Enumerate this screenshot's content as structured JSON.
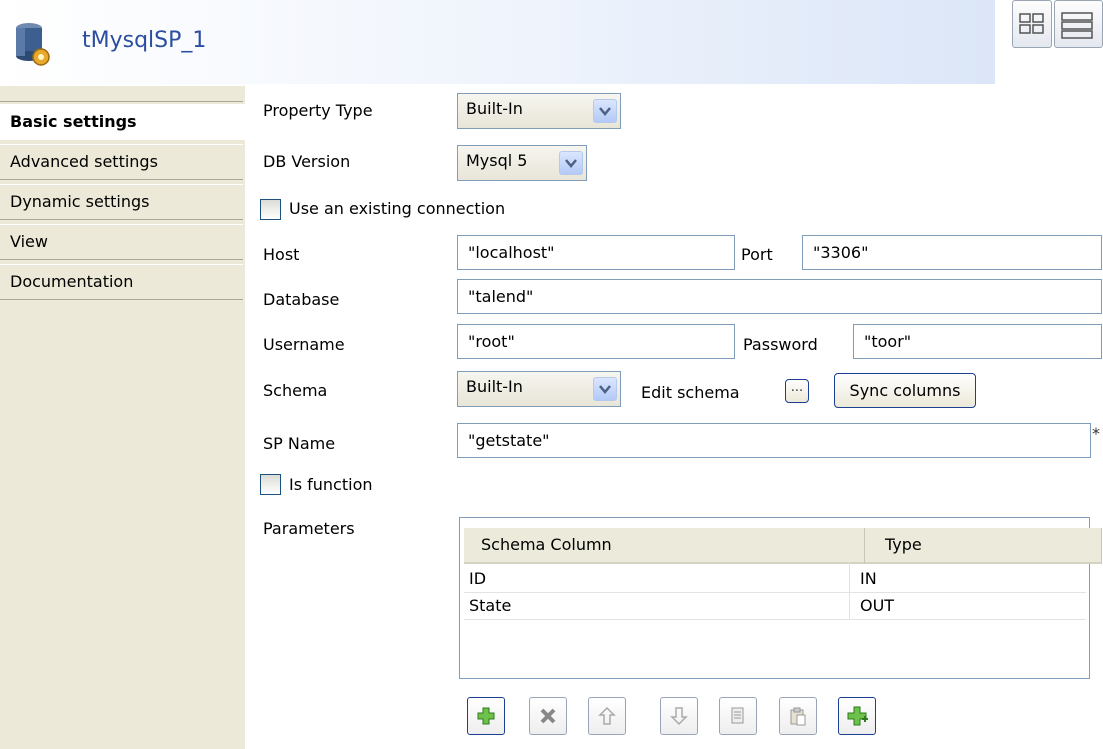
{
  "header": {
    "title": "tMysqlSP_1"
  },
  "nav": {
    "items": [
      {
        "label": "Basic settings"
      },
      {
        "label": "Advanced settings"
      },
      {
        "label": "Dynamic settings"
      },
      {
        "label": "View"
      },
      {
        "label": "Documentation"
      }
    ]
  },
  "form": {
    "property_type": {
      "label": "Property Type",
      "value": "Built-In"
    },
    "db_version": {
      "label": "DB Version",
      "value": "Mysql 5"
    },
    "use_existing_connection": {
      "label": "Use an existing connection",
      "checked": false
    },
    "host": {
      "label": "Host",
      "value": "\"localhost\""
    },
    "port": {
      "label": "Port",
      "value": "\"3306\""
    },
    "database": {
      "label": "Database",
      "value": "\"talend\""
    },
    "username": {
      "label": "Username",
      "value": "\"root\""
    },
    "password": {
      "label": "Password",
      "value": "\"toor\""
    },
    "schema": {
      "label": "Schema",
      "value": "Built-In",
      "edit_label": "Edit schema",
      "edit_button": "...",
      "sync_button": "Sync columns"
    },
    "sp_name": {
      "label": "SP Name",
      "value": "\"getstate\"",
      "required_mark": "*"
    },
    "is_function": {
      "label": "Is function",
      "checked": false
    },
    "parameters": {
      "label": "Parameters",
      "columns": [
        "Schema Column",
        "Type"
      ],
      "rows": [
        {
          "column": "ID",
          "type": "IN"
        },
        {
          "column": "State",
          "type": "OUT"
        }
      ]
    }
  },
  "toolbar": {
    "icons": [
      "add-icon",
      "delete-icon",
      "move-up-icon",
      "move-down-icon",
      "copy-icon",
      "paste-icon",
      "add-all-icon"
    ]
  },
  "colors": {
    "title": "#2b4ea0",
    "nav_bg": "#ece9d8",
    "field_border": "#7f9db9",
    "button_border": "#1c3f94"
  }
}
